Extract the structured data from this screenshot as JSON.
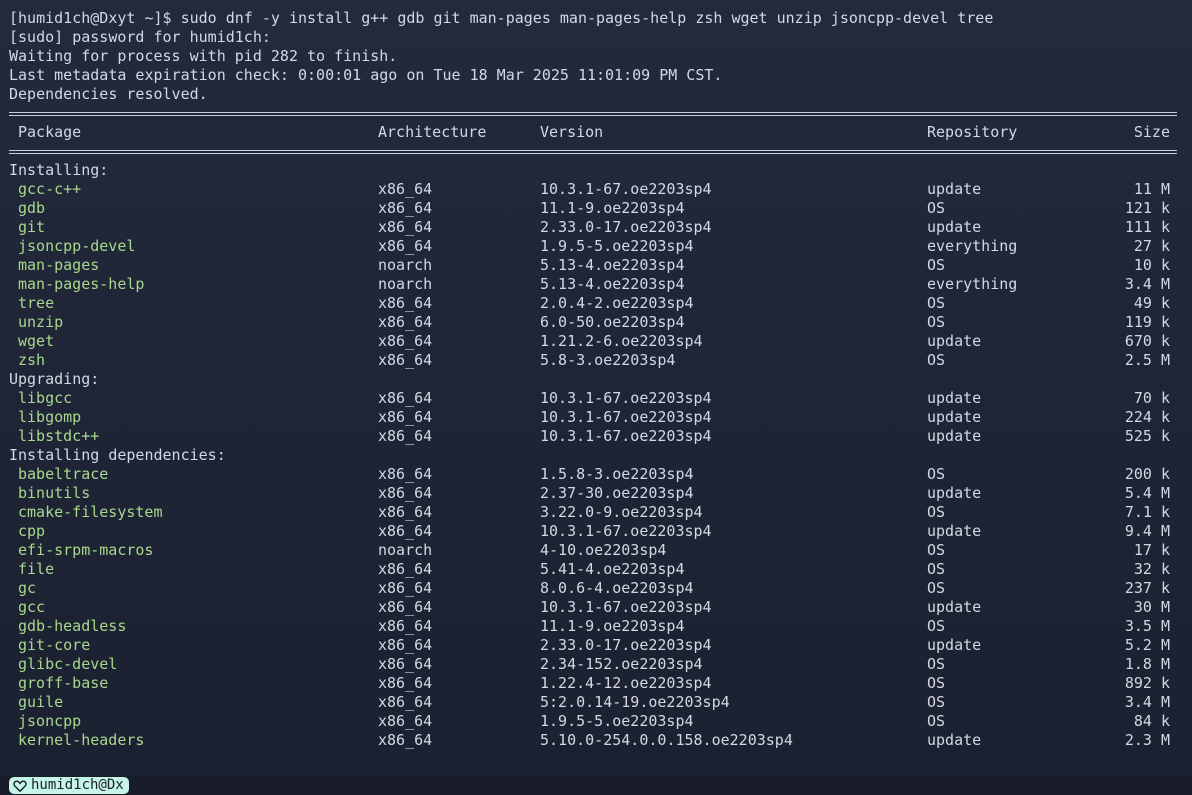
{
  "terminal": {
    "lines": [
      "[humid1ch@Dxyt ~]$ sudo dnf -y install g++ gdb git man-pages man-pages-help zsh wget unzip jsoncpp-devel tree",
      "[sudo] password for humid1ch:",
      "Waiting for process with pid 282 to finish.",
      "Last metadata expiration check: 0:00:01 ago on Tue 18 Mar 2025 11:01:09 PM CST.",
      "Dependencies resolved."
    ],
    "headers": {
      "package": "Package",
      "architecture": "Architecture",
      "version": "Version",
      "repository": "Repository",
      "size": "Size"
    },
    "sections": [
      {
        "title": "Installing:",
        "rows": [
          [
            "gcc-c++",
            "x86_64",
            "10.3.1-67.oe2203sp4",
            "update",
            "11 M"
          ],
          [
            "gdb",
            "x86_64",
            "11.1-9.oe2203sp4",
            "OS",
            "121 k"
          ],
          [
            "git",
            "x86_64",
            "2.33.0-17.oe2203sp4",
            "update",
            "111 k"
          ],
          [
            "jsoncpp-devel",
            "x86_64",
            "1.9.5-5.oe2203sp4",
            "everything",
            "27 k"
          ],
          [
            "man-pages",
            "noarch",
            "5.13-4.oe2203sp4",
            "OS",
            "10 k"
          ],
          [
            "man-pages-help",
            "noarch",
            "5.13-4.oe2203sp4",
            "everything",
            "3.4 M"
          ],
          [
            "tree",
            "x86_64",
            "2.0.4-2.oe2203sp4",
            "OS",
            "49 k"
          ],
          [
            "unzip",
            "x86_64",
            "6.0-50.oe2203sp4",
            "OS",
            "119 k"
          ],
          [
            "wget",
            "x86_64",
            "1.21.2-6.oe2203sp4",
            "update",
            "670 k"
          ],
          [
            "zsh",
            "x86_64",
            "5.8-3.oe2203sp4",
            "OS",
            "2.5 M"
          ]
        ]
      },
      {
        "title": "Upgrading:",
        "rows": [
          [
            "libgcc",
            "x86_64",
            "10.3.1-67.oe2203sp4",
            "update",
            "70 k"
          ],
          [
            "libgomp",
            "x86_64",
            "10.3.1-67.oe2203sp4",
            "update",
            "224 k"
          ],
          [
            "libstdc++",
            "x86_64",
            "10.3.1-67.oe2203sp4",
            "update",
            "525 k"
          ]
        ]
      },
      {
        "title": "Installing dependencies:",
        "rows": [
          [
            "babeltrace",
            "x86_64",
            "1.5.8-3.oe2203sp4",
            "OS",
            "200 k"
          ],
          [
            "binutils",
            "x86_64",
            "2.37-30.oe2203sp4",
            "update",
            "5.4 M"
          ],
          [
            "cmake-filesystem",
            "x86_64",
            "3.22.0-9.oe2203sp4",
            "OS",
            "7.1 k"
          ],
          [
            "cpp",
            "x86_64",
            "10.3.1-67.oe2203sp4",
            "update",
            "9.4 M"
          ],
          [
            "efi-srpm-macros",
            "noarch",
            "4-10.oe2203sp4",
            "OS",
            "17 k"
          ],
          [
            "file",
            "x86_64",
            "5.41-4.oe2203sp4",
            "OS",
            "32 k"
          ],
          [
            "gc",
            "x86_64",
            "8.0.6-4.oe2203sp4",
            "OS",
            "237 k"
          ],
          [
            "gcc",
            "x86_64",
            "10.3.1-67.oe2203sp4",
            "update",
            "30 M"
          ],
          [
            "gdb-headless",
            "x86_64",
            "11.1-9.oe2203sp4",
            "OS",
            "3.5 M"
          ],
          [
            "git-core",
            "x86_64",
            "2.33.0-17.oe2203sp4",
            "update",
            "5.2 M"
          ],
          [
            "glibc-devel",
            "x86_64",
            "2.34-152.oe2203sp4",
            "OS",
            "1.8 M"
          ],
          [
            "groff-base",
            "x86_64",
            "1.22.4-12.oe2203sp4",
            "OS",
            "892 k"
          ],
          [
            "guile",
            "x86_64",
            "5:2.0.14-19.oe2203sp4",
            "OS",
            "3.4 M"
          ],
          [
            "jsoncpp",
            "x86_64",
            "1.9.5-5.oe2203sp4",
            "OS",
            "84 k"
          ],
          [
            "kernel-headers",
            "x86_64",
            "5.10.0-254.0.0.158.oe2203sp4",
            "update",
            "2.3 M"
          ]
        ]
      }
    ]
  },
  "statusbar": {
    "session": "humid1ch@Dx",
    "icon": "heart-icon",
    "badge_color": "#c6f4e6"
  },
  "colors": {
    "background": "#1d2233",
    "text": "#d3d8e4",
    "package_name": "#a7d88c"
  }
}
